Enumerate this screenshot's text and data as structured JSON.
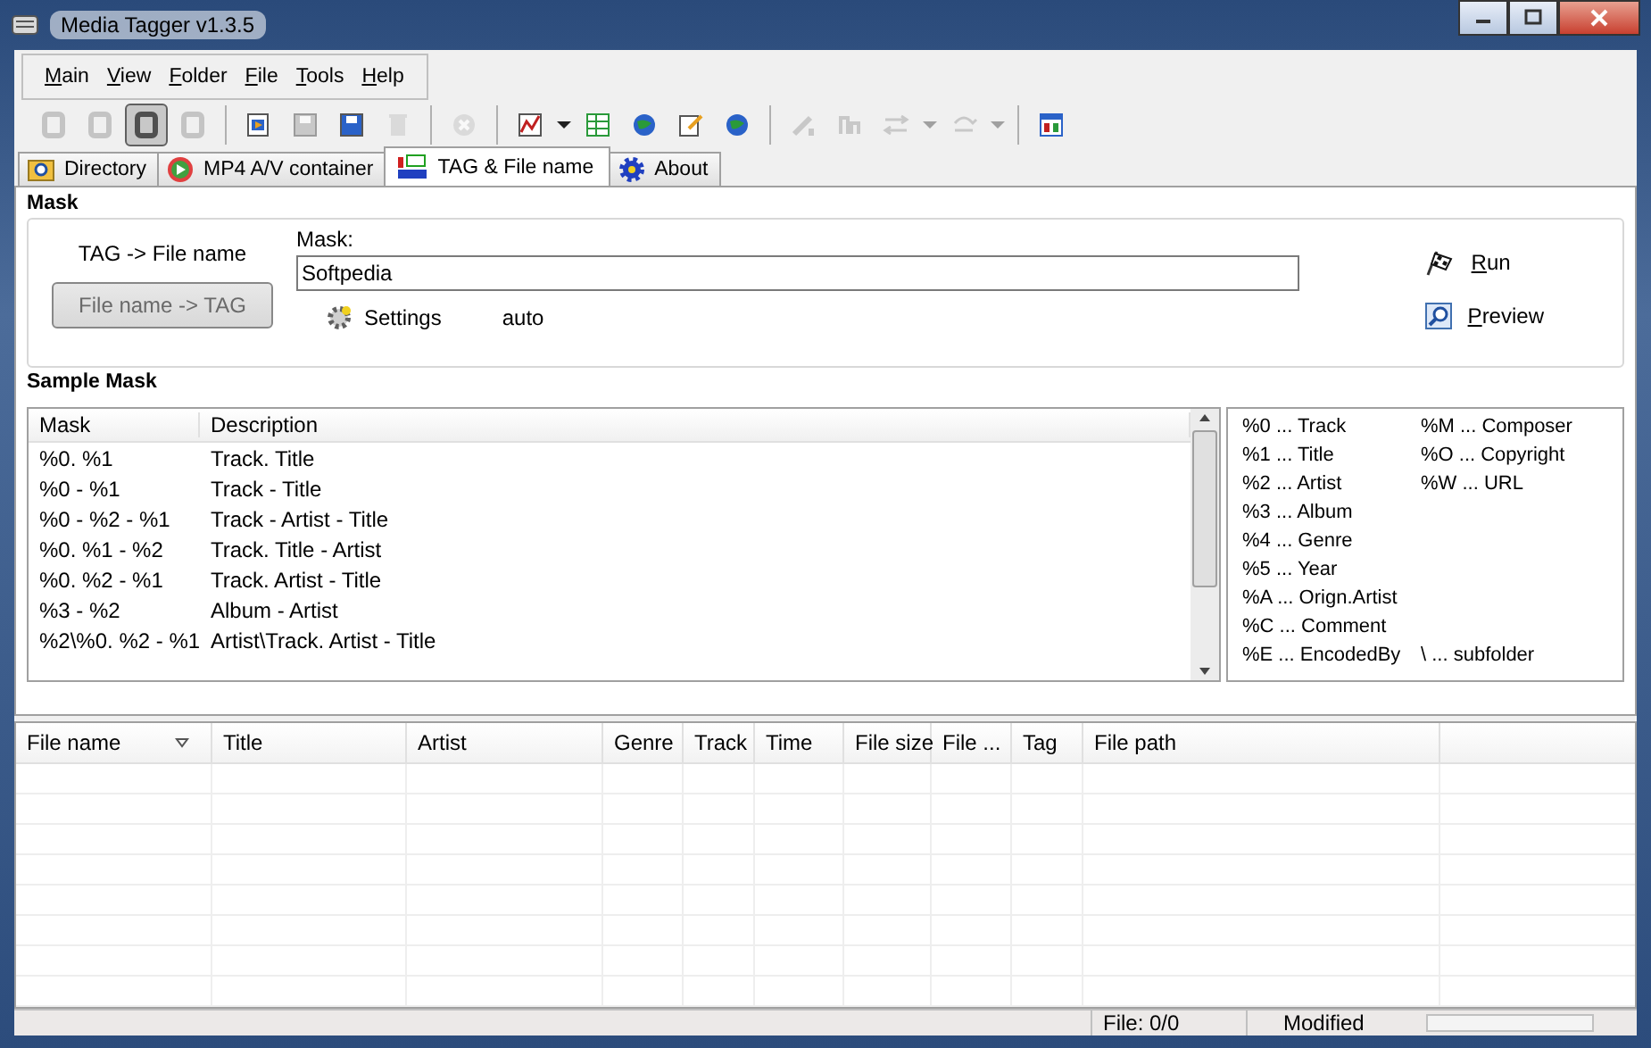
{
  "window": {
    "title": "Media Tagger v1.3.5"
  },
  "menu": [
    "Main",
    "View",
    "Folder",
    "File",
    "Tools",
    "Help"
  ],
  "toolbar": [
    {
      "kind": "button",
      "disabled": true,
      "pressed": false
    },
    {
      "kind": "button",
      "disabled": true,
      "pressed": false
    },
    {
      "kind": "button",
      "disabled": false,
      "pressed": true
    },
    {
      "kind": "button",
      "disabled": true,
      "pressed": false
    },
    {
      "kind": "separator"
    },
    {
      "kind": "button",
      "disabled": false,
      "pressed": false
    },
    {
      "kind": "button",
      "disabled": true,
      "pressed": false
    },
    {
      "kind": "button",
      "disabled": false,
      "pressed": false
    },
    {
      "kind": "button",
      "disabled": true,
      "pressed": false
    },
    {
      "kind": "separator"
    },
    {
      "kind": "button",
      "disabled": true,
      "pressed": false
    },
    {
      "kind": "separator"
    },
    {
      "kind": "button",
      "disabled": false,
      "pressed": false
    },
    {
      "kind": "dropdown",
      "disabled": false
    },
    {
      "kind": "button",
      "disabled": false,
      "pressed": false
    },
    {
      "kind": "button",
      "disabled": false,
      "pressed": false
    },
    {
      "kind": "button",
      "disabled": false,
      "pressed": false
    },
    {
      "kind": "button",
      "disabled": false,
      "pressed": false
    },
    {
      "kind": "separator"
    },
    {
      "kind": "button",
      "disabled": true,
      "pressed": false
    },
    {
      "kind": "button",
      "disabled": true,
      "pressed": false
    },
    {
      "kind": "button",
      "disabled": true,
      "pressed": false
    },
    {
      "kind": "dropdown",
      "disabled": true
    },
    {
      "kind": "button",
      "disabled": true,
      "pressed": false
    },
    {
      "kind": "dropdown",
      "disabled": true
    },
    {
      "kind": "separator"
    },
    {
      "kind": "button",
      "disabled": false,
      "pressed": false
    }
  ],
  "tabs": [
    {
      "label": "Directory",
      "selected": false
    },
    {
      "label": "MP4 A/V container",
      "selected": false
    },
    {
      "label": "TAG & File name",
      "selected": true
    },
    {
      "label": "About",
      "selected": false
    }
  ],
  "mask_group": {
    "title": "Mask",
    "direction_label": "TAG -> File name",
    "direction_button": {
      "label": "File name -> TAG",
      "disabled": true
    },
    "mask_label": "Mask:",
    "mask_value": "Softpedia",
    "settings_label": "Settings",
    "settings_value": "auto",
    "run_label": "Run",
    "preview_label": "Preview"
  },
  "sample_mask": {
    "title": "Sample Mask",
    "columns": [
      "Mask",
      "Description"
    ],
    "rows": [
      [
        "%0. %1",
        "Track. Title"
      ],
      [
        "%0 - %1",
        "Track - Title"
      ],
      [
        "%0 - %2 - %1",
        "Track - Artist - Title"
      ],
      [
        "%0. %1 - %2",
        "Track. Title - Artist"
      ],
      [
        "%0. %2 - %1",
        "Track. Artist - Title"
      ],
      [
        "%3 - %2",
        "Album - Artist"
      ],
      [
        "%2\\%0. %2 - %1",
        "Artist\\Track. Artist - Title"
      ]
    ],
    "codes_column_1": [
      "%0 ... Track",
      "%1 ... Title",
      "%2 ... Artist",
      "%3 ... Album",
      "%4 ... Genre",
      "%5 ... Year",
      "%A ... Orign.Artist",
      "%C ... Comment",
      "%E ... EncodedBy"
    ],
    "codes_column_2": [
      "%M ... Composer",
      "%O ... Copyright",
      "%W ... URL"
    ],
    "subfolder_hint": "\\ ... subfolder"
  },
  "files": {
    "columns": [
      {
        "label": "File name",
        "sorted": true
      },
      {
        "label": "Title",
        "sorted": false
      },
      {
        "label": "Artist",
        "sorted": false
      },
      {
        "label": "Genre",
        "sorted": false
      },
      {
        "label": "Track",
        "sorted": false
      },
      {
        "label": "Time",
        "sorted": false
      },
      {
        "label": "File size",
        "sorted": false
      },
      {
        "label": "File ...",
        "sorted": false
      },
      {
        "label": "Tag",
        "sorted": false
      },
      {
        "label": "File path",
        "sorted": false
      }
    ]
  },
  "status_bar": {
    "file_count": "File: 0/0",
    "state": "Modified"
  }
}
